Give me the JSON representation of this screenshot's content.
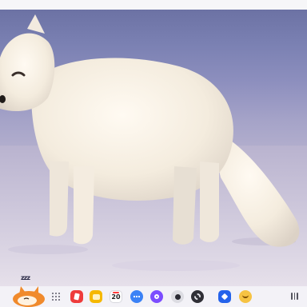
{
  "wallpaper": {
    "subject": "arctic-fox-on-snow"
  },
  "taskbar": {
    "mascot_sleep_text": "zzz",
    "apps": [
      {
        "icon": "red-notes-app-icon",
        "color": "#ee3b3b"
      },
      {
        "icon": "yellow-folder-app-icon",
        "color": "#f5b800"
      },
      {
        "icon": "calendar-app-icon",
        "color": "#ffffff",
        "label": "20"
      },
      {
        "icon": "messages-app-icon",
        "color": "#3b82f6"
      },
      {
        "icon": "purple-app-icon",
        "color": "#7c4dff"
      },
      {
        "icon": "camera-app-icon",
        "color": "#dcdce2"
      },
      {
        "icon": "settings-app-icon",
        "color": "#2f2f36"
      },
      {
        "icon": "blue-app-icon",
        "color": "#2563eb"
      },
      {
        "icon": "emoji-app-icon",
        "color": "#f6c343"
      }
    ]
  }
}
